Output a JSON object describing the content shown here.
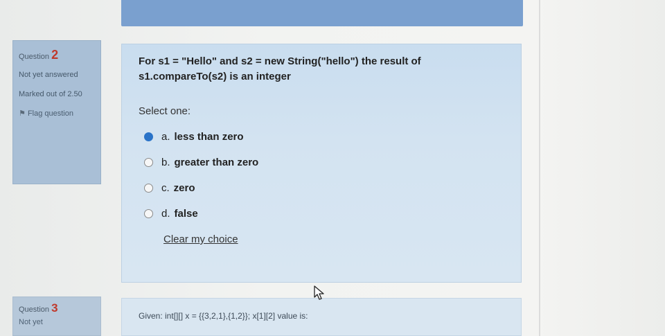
{
  "question2": {
    "label": "Question",
    "number": "2",
    "state": "Not yet answered",
    "grade": "Marked out of 2.50",
    "flag_label": "Flag question",
    "text": "For s1 = \"Hello\" and s2 = new String(\"hello\") the result of s1.compareTo(s2) is an integer",
    "prompt": "Select one:",
    "answers": [
      {
        "letter": "a.",
        "text": "less than zero",
        "checked": true
      },
      {
        "letter": "b.",
        "text": "greater than zero",
        "checked": false
      },
      {
        "letter": "c.",
        "text": "zero",
        "checked": false
      },
      {
        "letter": "d.",
        "text": "false",
        "checked": false
      }
    ],
    "clear_label": "Clear my choice"
  },
  "question3": {
    "label": "Question",
    "number": "3",
    "state": "Not yet",
    "text": "Given:  int[][] x = {{3,2,1},{1,2}};   x[1][2] value is:"
  },
  "colors": {
    "accent_bar": "#7aa0cf",
    "info_box": "#a9bfd6",
    "content_box": "#d3e3f1",
    "question_number": "#c0392b",
    "radio_checked": "#2a73c8"
  }
}
